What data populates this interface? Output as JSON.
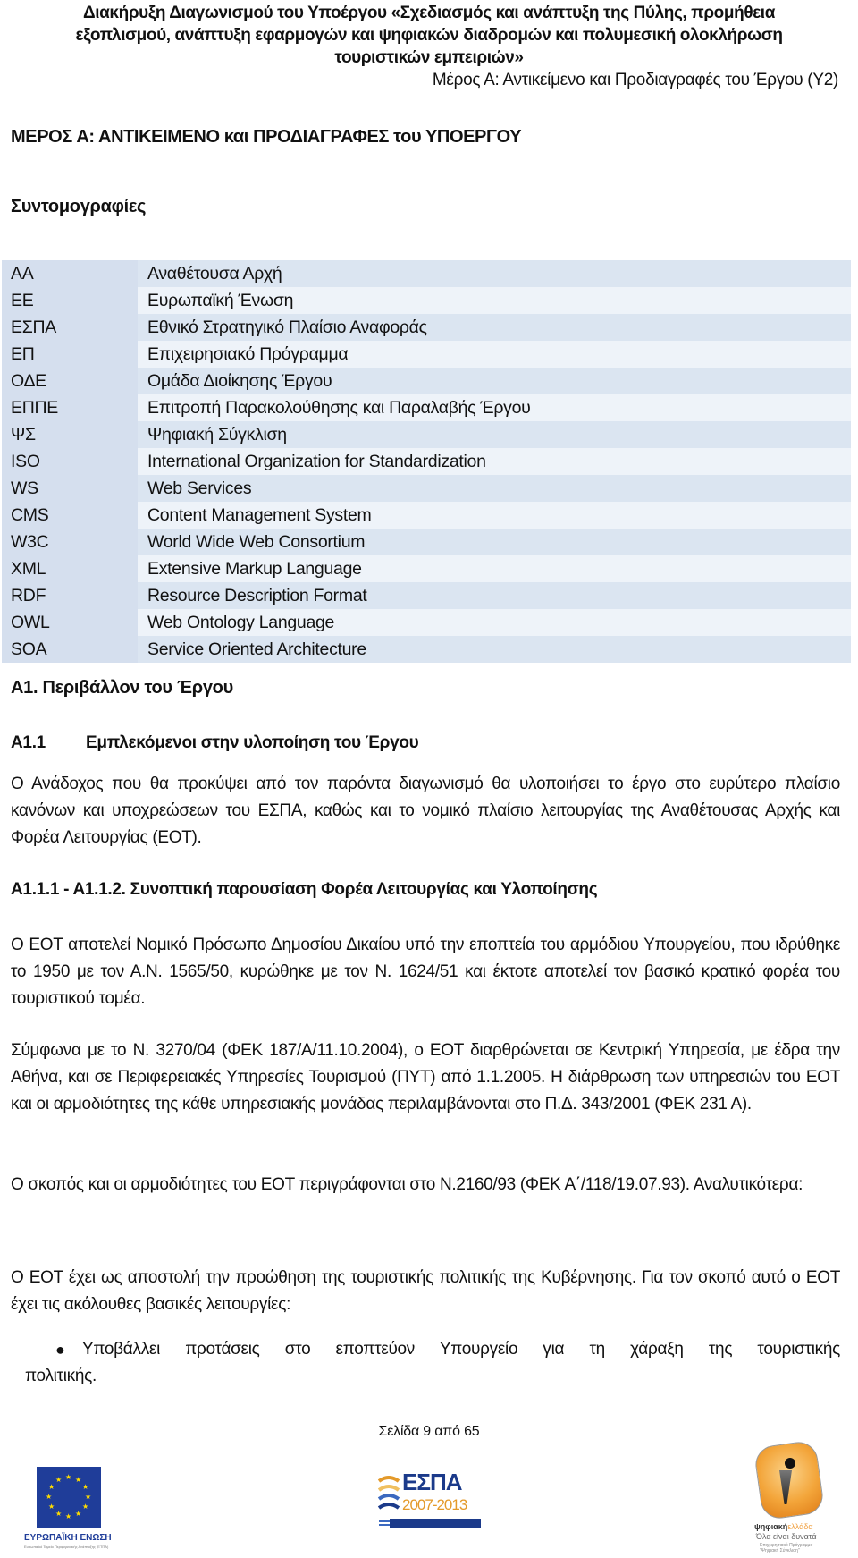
{
  "header": {
    "title": "Διακήρυξη Διαγωνισμού του Υποέργου «Σχεδιασμός και ανάπτυξη της Πύλης, προμήθεια εξοπλισμού, ανάπτυξη εφαρμογών και ψηφιακών διαδρομών και πολυμεσική ολοκλήρωση τουριστικών εμπειριών»",
    "title_lines": [
      "Διακήρυξη Διαγωνισμού του Υποέργου «Σχεδιασμός και ανάπτυξη της Πύλης, προμήθεια",
      "εξοπλισμού, ανάπτυξη εφαρμογών και ψηφιακών διαδρομών και πολυμεσική ολοκλήρωση",
      "τουριστικών εμπειριών»"
    ],
    "subtitle": "Μέρος Α: Αντικείμενο και Προδιαγραφές του Έργου (Υ2)"
  },
  "part_heading": "ΜΕΡΟΣ Α: ΑΝΤΙΚΕΙΜΕΝΟ και ΠΡΟΔΙΑΓΡΑΦΕΣ του ΥΠΟΕΡΓΟΥ",
  "abbreviations": {
    "heading": "Συντομογραφίες",
    "rows": [
      {
        "abbr": "ΑΑ",
        "meaning": "Αναθέτουσα Αρχή"
      },
      {
        "abbr": "ΕΕ",
        "meaning": "Ευρωπαϊκή Ένωση"
      },
      {
        "abbr": "ΕΣΠΑ",
        "meaning": "Εθνικό Στρατηγικό Πλαίσιο Αναφοράς"
      },
      {
        "abbr": "ΕΠ",
        "meaning": "Επιχειρησιακό Πρόγραμμα"
      },
      {
        "abbr": "ΟΔΕ",
        "meaning": "Ομάδα Διοίκησης Έργου"
      },
      {
        "abbr": "ΕΠΠΕ",
        "meaning": "Επιτροπή Παρακολούθησης και Παραλαβής Έργου"
      },
      {
        "abbr": "ΨΣ",
        "meaning": "Ψηφιακή Σύγκλιση"
      },
      {
        "abbr": "ISO",
        "meaning": "International Organization for Standardization"
      },
      {
        "abbr": "WS",
        "meaning": "Web Services"
      },
      {
        "abbr": "CMS",
        "meaning": "Content Management System"
      },
      {
        "abbr": "W3C",
        "meaning": "World Wide Web Consortium"
      },
      {
        "abbr": "XML",
        "meaning": "Extensive Markup Language"
      },
      {
        "abbr": "RDF",
        "meaning": "Resource Description Format"
      },
      {
        "abbr": "OWL",
        "meaning": "Web Ontology Language"
      },
      {
        "abbr": "SOA",
        "meaning": "Service Oriented Architecture"
      }
    ]
  },
  "section_a1": {
    "heading": "Α1. Περιβάλλον του Έργου",
    "sub": {
      "number": "Α1.1",
      "title": "Εμπλεκόμενοι στην υλοποίηση του Έργου",
      "paragraph": "Ο Ανάδοχος που θα προκύψει από τον παρόντα διαγωνισμό θα υλοποιήσει το έργο στο ευρύτερο πλαίσιο κανόνων και υποχρεώσεων του ΕΣΠΑ, καθώς και το νομικό πλαίσιο λειτουργίας της Αναθέτουσας Αρχής και Φορέα Λειτουργίας (ΕΟΤ)."
    },
    "sub2": {
      "heading": "Α1.1.1 - Α1.1.2. Συνοπτική παρουσίαση  Φορέα Λειτουργίας και Υλοποίησης",
      "paragraphs": [
        "Ο ΕΟΤ αποτελεί Νομικό Πρόσωπο Δημοσίου Δικαίου υπό την εποπτεία του αρμόδιου Υπουργείου, που ιδρύθηκε το 1950 με τον Α.Ν. 1565/50, κυρώθηκε με τον Ν. 1624/51 και έκτοτε αποτελεί τον βασικό κρατικό φορέα του τουριστικού τομέα.",
        "Σύμφωνα με το Ν. 3270/04 (ΦΕΚ 187/Α/11.10.2004), ο ΕΟΤ διαρθρώνεται σε Κεντρική Υπηρεσία, με έδρα την Αθήνα, και σε Περιφερειακές Υπηρεσίες Τουρισμού (ΠΥΤ) από 1.1.2005. Η διάρθρωση των υπηρεσιών του ΕΟΤ και οι αρμοδιότητες της κάθε υπηρεσιακής μονάδας περιλαμβάνονται στο Π.Δ. 343/2001 (ΦΕΚ 231 Α).",
        "Ο σκοπός και οι αρμοδιότητες του ΕΟΤ περιγράφονται στο Ν.2160/93 (ΦΕΚ Α΄/118/19.07.93). Αναλυτικότερα:",
        "Ο ΕΟΤ έχει ως αποστολή την προώθηση της τουριστικής πολιτικής της Κυβέρνησης. Για τον σκοπό αυτό ο ΕΟΤ έχει τις ακόλουθες βασικές λειτουργίες:"
      ],
      "bullets": [
        {
          "line1": "Υποβάλλει προτάσεις στο εποπτεύον Υπουργείο για τη χάραξη της τουριστικής",
          "line2": "πολιτικής."
        }
      ]
    }
  },
  "footer": {
    "page_label": "Σελίδα 9 από 65",
    "logos": {
      "eu": {
        "label": "ΕΥΡΩΠΑΪΚΗ ΕΝΩΣΗ",
        "small": "Ευρωπαϊκό Ταμείο Περιφερειακής Ανάπτυξης (ΕΤΠΑ)"
      },
      "espa": {
        "label": "ΕΣΠΑ",
        "years": "2007-2013"
      },
      "dh": {
        "brand_a": "ψηφιακή",
        "brand_b": "ελλάδα",
        "slogan": "Όλα είναι δυνατά",
        "small": "Επιχειρησιακό Πρόγραμμα \"Ψηφιακή Σύγκλιση\""
      }
    }
  },
  "colors": {
    "table_key_bg": "#d5dfee",
    "table_row_odd": "#dbe5f1",
    "table_row_even": "#eef3f9",
    "eu_blue": "#1f3d99",
    "espa_blue": "#1b3a8a",
    "espa_orange": "#e49a2a"
  }
}
